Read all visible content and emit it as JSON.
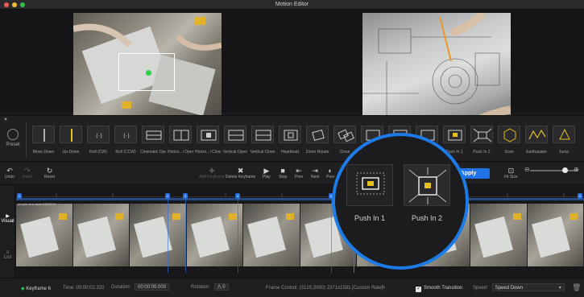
{
  "window": {
    "title": "Motion Editor"
  },
  "preset": {
    "label": "Preset"
  },
  "effects": [
    {
      "label": "Move Down"
    },
    {
      "label": "Up-Down"
    },
    {
      "label": "Roll (CW)"
    },
    {
      "label": "Roll (CCW)"
    },
    {
      "label": "Cinematic Open"
    },
    {
      "label": "Horizo...l Open"
    },
    {
      "label": "Horizo...l Close"
    },
    {
      "label": "Vertical Open"
    },
    {
      "label": "Vertical Close"
    },
    {
      "label": "Heartbeat"
    },
    {
      "label": "Zoom Rotate"
    },
    {
      "label": "Close"
    },
    {
      "label": ""
    },
    {
      "label": ""
    },
    {
      "label": ""
    },
    {
      "label": "Push In 1"
    },
    {
      "label": "Push In 2"
    },
    {
      "label": "Scan"
    },
    {
      "label": "Earthquake"
    },
    {
      "label": "Jump"
    }
  ],
  "toolbar": {
    "undo": "Undo",
    "redo": "Redo",
    "reset": "Reset",
    "add_keyframe": "Add Keyframe",
    "delete_keyframe": "Delete Keyframe",
    "play": "Play",
    "stop": "Stop",
    "prev": "Prev",
    "next": "Next",
    "preview": "Prev",
    "apply": "Apply",
    "fit_size": "Fit Size"
  },
  "timeline": {
    "clip_label": "people-at-a-desk-5324674",
    "side_tabs": {
      "visual": "Visual",
      "list": "List"
    },
    "keyframes": [
      "1",
      "2",
      "3",
      "4",
      "5",
      "6"
    ]
  },
  "magnifier": {
    "items": [
      {
        "label": "Push In 1"
      },
      {
        "label": "Push In 2"
      }
    ]
  },
  "status": {
    "keyframe_label": "Keyframe 6",
    "time_label": "Time:",
    "time_value": "00:00:02.320",
    "duration_label": "Duration:",
    "duration_value": "00:00:00.000",
    "rotation_label": "Rotation:",
    "rotation_value": "⋀ 0",
    "frame_control_label": "Frame Control:",
    "frame_control_value": "(3120,2080)  2371x1581  [Custom Rate]",
    "smooth_label": "Smooth Transition",
    "smooth_checked": true,
    "speed_label": "Speed:",
    "speed_value": "Speed Down"
  },
  "colors": {
    "accent": "#1f73e6",
    "keyframe": "#2a6fe0",
    "playhead": "#e33b3b",
    "focus_dot": "#2fd14a"
  }
}
